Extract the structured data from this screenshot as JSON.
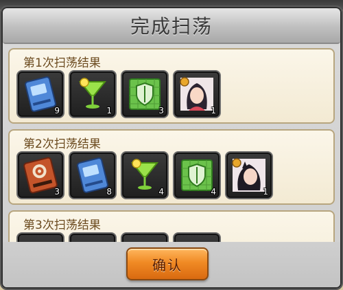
{
  "dialog": {
    "title": "完成扫荡",
    "confirm_label": "确认"
  },
  "results": [
    {
      "title": "第1次扫荡结果",
      "items": [
        {
          "icon": "blue-book-icon",
          "qty": "9"
        },
        {
          "icon": "green-cocktail-icon",
          "qty": "1"
        },
        {
          "icon": "green-shield-map-icon",
          "qty": "3"
        },
        {
          "icon": "character-portrait-icon",
          "qty": "1"
        }
      ]
    },
    {
      "title": "第2次扫荡结果",
      "items": [
        {
          "icon": "training-book-icon",
          "qty": "3"
        },
        {
          "icon": "blue-book-icon",
          "qty": "8"
        },
        {
          "icon": "green-cocktail-icon",
          "qty": "4"
        },
        {
          "icon": "green-shield-map-icon",
          "qty": "4"
        },
        {
          "icon": "character-portrait-icon",
          "qty": "1"
        }
      ]
    },
    {
      "title": "第3次扫荡结果",
      "items": []
    }
  ],
  "colors": {
    "accent_orange": "#f08a24",
    "card_bg": "#f7f0dd",
    "title_text": "#6b4a1e"
  }
}
